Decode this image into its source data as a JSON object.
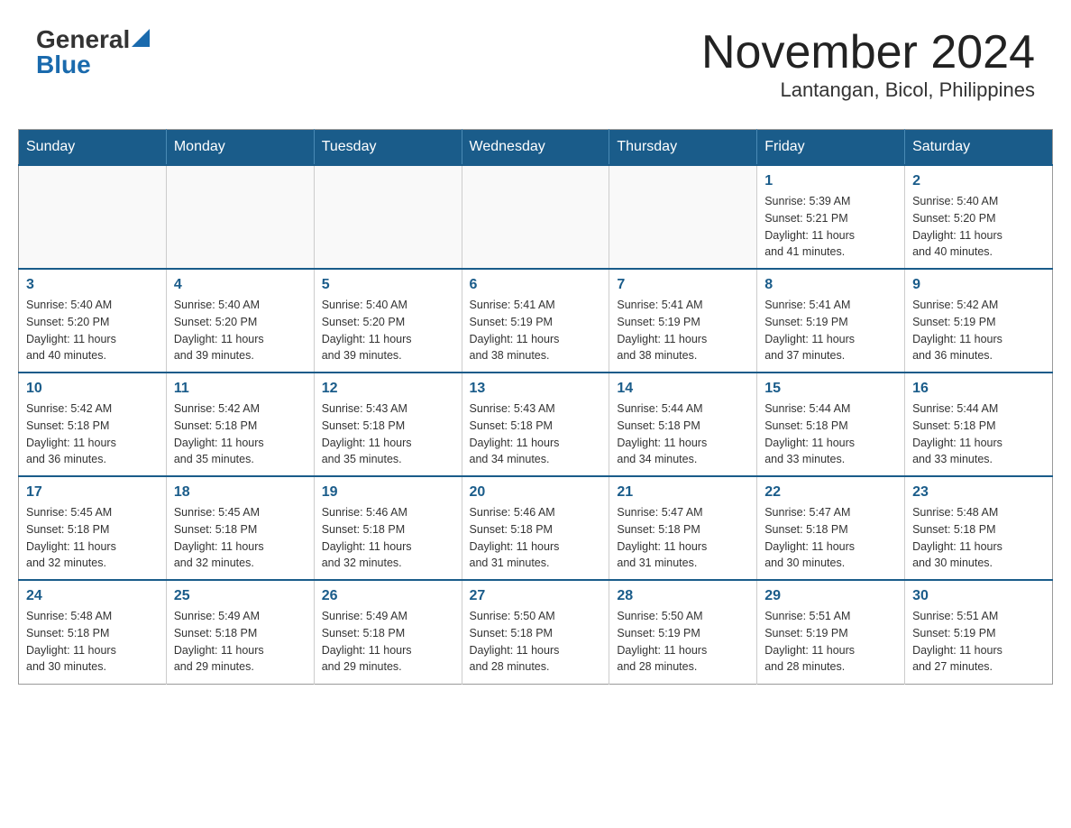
{
  "header": {
    "logo_general": "General",
    "logo_blue": "Blue",
    "month_title": "November 2024",
    "location": "Lantangan, Bicol, Philippines"
  },
  "calendar": {
    "days_of_week": [
      "Sunday",
      "Monday",
      "Tuesday",
      "Wednesday",
      "Thursday",
      "Friday",
      "Saturday"
    ],
    "weeks": [
      [
        {
          "day": "",
          "info": ""
        },
        {
          "day": "",
          "info": ""
        },
        {
          "day": "",
          "info": ""
        },
        {
          "day": "",
          "info": ""
        },
        {
          "day": "",
          "info": ""
        },
        {
          "day": "1",
          "info": "Sunrise: 5:39 AM\nSunset: 5:21 PM\nDaylight: 11 hours\nand 41 minutes."
        },
        {
          "day": "2",
          "info": "Sunrise: 5:40 AM\nSunset: 5:20 PM\nDaylight: 11 hours\nand 40 minutes."
        }
      ],
      [
        {
          "day": "3",
          "info": "Sunrise: 5:40 AM\nSunset: 5:20 PM\nDaylight: 11 hours\nand 40 minutes."
        },
        {
          "day": "4",
          "info": "Sunrise: 5:40 AM\nSunset: 5:20 PM\nDaylight: 11 hours\nand 39 minutes."
        },
        {
          "day": "5",
          "info": "Sunrise: 5:40 AM\nSunset: 5:20 PM\nDaylight: 11 hours\nand 39 minutes."
        },
        {
          "day": "6",
          "info": "Sunrise: 5:41 AM\nSunset: 5:19 PM\nDaylight: 11 hours\nand 38 minutes."
        },
        {
          "day": "7",
          "info": "Sunrise: 5:41 AM\nSunset: 5:19 PM\nDaylight: 11 hours\nand 38 minutes."
        },
        {
          "day": "8",
          "info": "Sunrise: 5:41 AM\nSunset: 5:19 PM\nDaylight: 11 hours\nand 37 minutes."
        },
        {
          "day": "9",
          "info": "Sunrise: 5:42 AM\nSunset: 5:19 PM\nDaylight: 11 hours\nand 36 minutes."
        }
      ],
      [
        {
          "day": "10",
          "info": "Sunrise: 5:42 AM\nSunset: 5:18 PM\nDaylight: 11 hours\nand 36 minutes."
        },
        {
          "day": "11",
          "info": "Sunrise: 5:42 AM\nSunset: 5:18 PM\nDaylight: 11 hours\nand 35 minutes."
        },
        {
          "day": "12",
          "info": "Sunrise: 5:43 AM\nSunset: 5:18 PM\nDaylight: 11 hours\nand 35 minutes."
        },
        {
          "day": "13",
          "info": "Sunrise: 5:43 AM\nSunset: 5:18 PM\nDaylight: 11 hours\nand 34 minutes."
        },
        {
          "day": "14",
          "info": "Sunrise: 5:44 AM\nSunset: 5:18 PM\nDaylight: 11 hours\nand 34 minutes."
        },
        {
          "day": "15",
          "info": "Sunrise: 5:44 AM\nSunset: 5:18 PM\nDaylight: 11 hours\nand 33 minutes."
        },
        {
          "day": "16",
          "info": "Sunrise: 5:44 AM\nSunset: 5:18 PM\nDaylight: 11 hours\nand 33 minutes."
        }
      ],
      [
        {
          "day": "17",
          "info": "Sunrise: 5:45 AM\nSunset: 5:18 PM\nDaylight: 11 hours\nand 32 minutes."
        },
        {
          "day": "18",
          "info": "Sunrise: 5:45 AM\nSunset: 5:18 PM\nDaylight: 11 hours\nand 32 minutes."
        },
        {
          "day": "19",
          "info": "Sunrise: 5:46 AM\nSunset: 5:18 PM\nDaylight: 11 hours\nand 32 minutes."
        },
        {
          "day": "20",
          "info": "Sunrise: 5:46 AM\nSunset: 5:18 PM\nDaylight: 11 hours\nand 31 minutes."
        },
        {
          "day": "21",
          "info": "Sunrise: 5:47 AM\nSunset: 5:18 PM\nDaylight: 11 hours\nand 31 minutes."
        },
        {
          "day": "22",
          "info": "Sunrise: 5:47 AM\nSunset: 5:18 PM\nDaylight: 11 hours\nand 30 minutes."
        },
        {
          "day": "23",
          "info": "Sunrise: 5:48 AM\nSunset: 5:18 PM\nDaylight: 11 hours\nand 30 minutes."
        }
      ],
      [
        {
          "day": "24",
          "info": "Sunrise: 5:48 AM\nSunset: 5:18 PM\nDaylight: 11 hours\nand 30 minutes."
        },
        {
          "day": "25",
          "info": "Sunrise: 5:49 AM\nSunset: 5:18 PM\nDaylight: 11 hours\nand 29 minutes."
        },
        {
          "day": "26",
          "info": "Sunrise: 5:49 AM\nSunset: 5:18 PM\nDaylight: 11 hours\nand 29 minutes."
        },
        {
          "day": "27",
          "info": "Sunrise: 5:50 AM\nSunset: 5:18 PM\nDaylight: 11 hours\nand 28 minutes."
        },
        {
          "day": "28",
          "info": "Sunrise: 5:50 AM\nSunset: 5:19 PM\nDaylight: 11 hours\nand 28 minutes."
        },
        {
          "day": "29",
          "info": "Sunrise: 5:51 AM\nSunset: 5:19 PM\nDaylight: 11 hours\nand 28 minutes."
        },
        {
          "day": "30",
          "info": "Sunrise: 5:51 AM\nSunset: 5:19 PM\nDaylight: 11 hours\nand 27 minutes."
        }
      ]
    ]
  }
}
